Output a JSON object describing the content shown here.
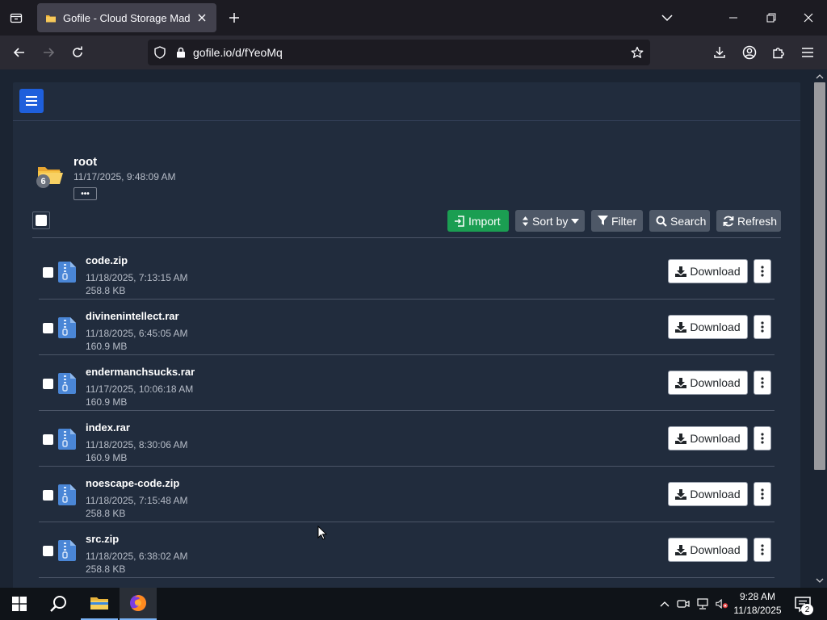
{
  "browser": {
    "tab_title": "Gofile - Cloud Storage Made Simple",
    "url": "gofile.io/d/fYeoMq"
  },
  "folder": {
    "name": "root",
    "date": "11/17/2025, 9:48:09 AM",
    "item_count": "6",
    "more_label": "•••"
  },
  "toolbar": {
    "import_label": "Import",
    "sort_label": "Sort by",
    "filter_label": "Filter",
    "search_label": "Search",
    "refresh_label": "Refresh"
  },
  "files": [
    {
      "name": "code.zip",
      "date": "11/18/2025, 7:13:15 AM",
      "size": "258.8 KB",
      "download_label": "Download"
    },
    {
      "name": "divinenintellect.rar",
      "date": "11/18/2025, 6:45:05 AM",
      "size": "160.9 MB",
      "download_label": "Download"
    },
    {
      "name": "endermanchsucks.rar",
      "date": "11/17/2025, 10:06:18 AM",
      "size": "160.9 MB",
      "download_label": "Download"
    },
    {
      "name": "index.rar",
      "date": "11/18/2025, 8:30:06 AM",
      "size": "160.9 MB",
      "download_label": "Download"
    },
    {
      "name": "noescape-code.zip",
      "date": "11/18/2025, 7:15:48 AM",
      "size": "258.8 KB",
      "download_label": "Download"
    },
    {
      "name": "src.zip",
      "date": "11/18/2025, 6:38:02 AM",
      "size": "258.8 KB",
      "download_label": "Download"
    }
  ],
  "taskbar": {
    "time": "9:28 AM",
    "date": "11/18/2025",
    "notification_count": "2"
  },
  "colors": {
    "page_bg": "#1b2432",
    "card_bg": "#212c3d",
    "menu_button": "#1e5fdc",
    "import_button": "#1b9e52",
    "secondary_button": "#4e5867",
    "file_icon": "#4a86d6"
  },
  "icons": {
    "tab_list": "tab-list-icon",
    "favicon": "gofile-favicon",
    "new_tab": "plus-icon",
    "back": "back-arrow-icon",
    "forward": "forward-arrow-icon",
    "reload": "reload-icon",
    "shield": "shield-icon",
    "lock": "lock-icon",
    "bookmark": "star-icon",
    "downloads": "download-icon",
    "account": "account-icon",
    "extensions": "puzzle-icon",
    "app_menu": "hamburger-icon",
    "folder": "folder-icon",
    "archive": "zip-file-icon",
    "kebab": "vertical-dots-icon"
  }
}
